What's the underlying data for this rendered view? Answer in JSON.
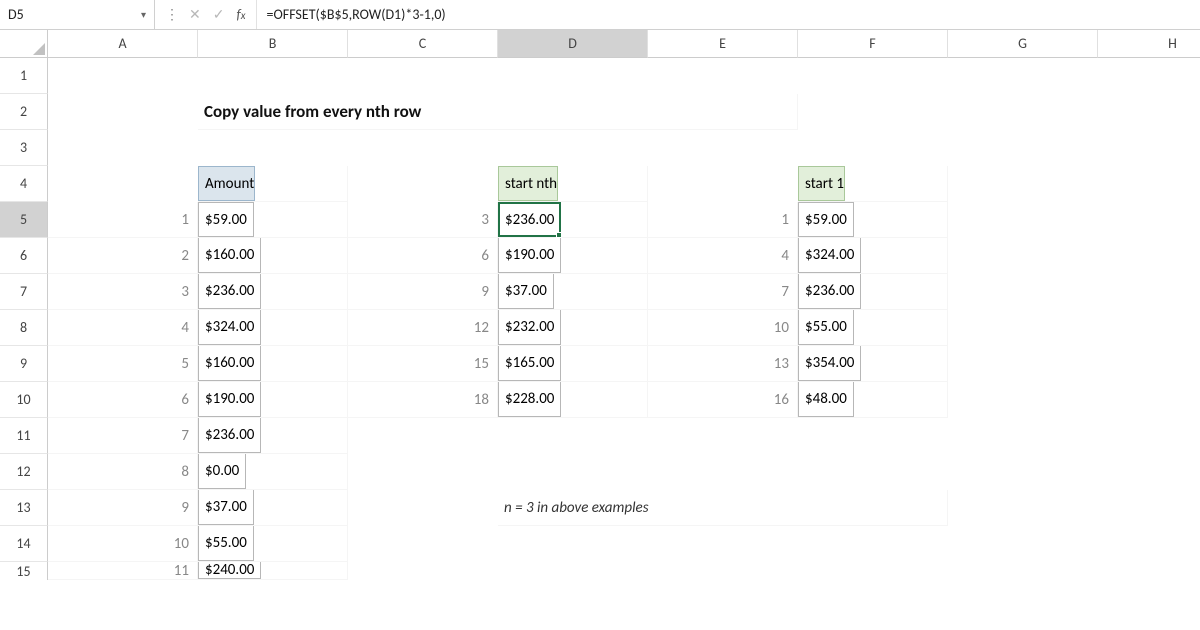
{
  "name_box": "D5",
  "formula": "=OFFSET($B$5,ROW(D1)*3-1,0)",
  "columns": [
    "A",
    "B",
    "C",
    "D",
    "E",
    "F",
    "G",
    "H"
  ],
  "selected_col_index": 3,
  "selected_row_index": 4,
  "rows": [
    "1",
    "2",
    "3",
    "4",
    "5",
    "6",
    "7",
    "8",
    "9",
    "10",
    "11",
    "12",
    "13",
    "14",
    "15"
  ],
  "title": "Copy value from every nth row",
  "headers": {
    "amount": "Amount",
    "start_nth": "start nth",
    "start_1": "start 1"
  },
  "note": "n = 3 in above examples",
  "col_A_idx": [
    "1",
    "2",
    "3",
    "4",
    "5",
    "6",
    "7",
    "8",
    "9",
    "10",
    "11"
  ],
  "col_B_vals": [
    "$59.00",
    "$160.00",
    "$236.00",
    "$324.00",
    "$160.00",
    "$190.00",
    "$236.00",
    "$0.00",
    "$37.00",
    "$55.00",
    "$240.00"
  ],
  "col_C_idx": [
    "3",
    "6",
    "9",
    "12",
    "15",
    "18"
  ],
  "col_D_vals": [
    "$236.00",
    "$190.00",
    "$37.00",
    "$232.00",
    "$165.00",
    "$228.00"
  ],
  "col_E_idx": [
    "1",
    "4",
    "7",
    "10",
    "13",
    "16"
  ],
  "col_F_vals": [
    "$59.00",
    "$324.00",
    "$236.00",
    "$55.00",
    "$354.00",
    "$48.00"
  ]
}
